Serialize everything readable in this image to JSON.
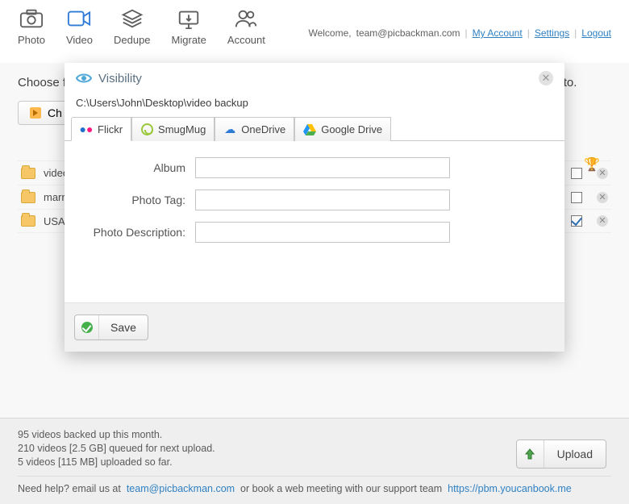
{
  "toolbar": {
    "items": [
      {
        "label": "Photo"
      },
      {
        "label": "Video"
      },
      {
        "label": "Dedupe"
      },
      {
        "label": "Migrate"
      },
      {
        "label": "Account"
      }
    ]
  },
  "header": {
    "welcome_prefix": "Welcome,",
    "email": "team@picbackman.com",
    "my_account": "My Account",
    "settings": "Settings",
    "logout": "Logout"
  },
  "main": {
    "choose_text_prefix": "Choose f",
    "choose_text_suffix": "eos to.",
    "choose_btn_label": "Ch"
  },
  "folders": [
    {
      "name": "video"
    },
    {
      "name": "marria"
    },
    {
      "name": "USA tr",
      "checked": true
    }
  ],
  "modal": {
    "title": "Visibility",
    "path": "C:\\Users\\John\\Desktop\\video backup",
    "tabs": [
      {
        "label": "Flickr"
      },
      {
        "label": "SmugMug"
      },
      {
        "label": "OneDrive"
      },
      {
        "label": "Google Drive"
      }
    ],
    "form": {
      "album_label": "Album",
      "tag_label": "Photo Tag:",
      "desc_label": "Photo Description:",
      "album_value": "",
      "tag_value": "",
      "desc_value": ""
    },
    "save_label": "Save"
  },
  "footer": {
    "line1": "95 videos backed up this month.",
    "line2": "210 videos [2.5 GB] queued for next upload.",
    "line3": "5 videos [115 MB] uploaded so far.",
    "upload_label": "Upload",
    "help_prefix": "Need help? email us at",
    "help_email": "team@picbackman.com",
    "help_mid": "or book a web meeting with our support team",
    "help_link": "https://pbm.youcanbook.me"
  }
}
